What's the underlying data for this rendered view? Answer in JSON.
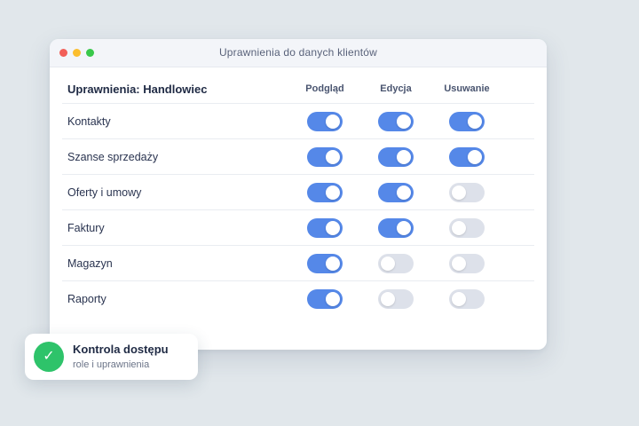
{
  "window": {
    "title": "Uprawnienia do danych klientów"
  },
  "table": {
    "role_label": "Uprawnienia: Handlowiec",
    "columns": [
      "Podgląd",
      "Edycja",
      "Usuwanie"
    ],
    "rows": [
      {
        "label": "Kontakty",
        "values": [
          true,
          true,
          true
        ]
      },
      {
        "label": "Szanse sprzedaży",
        "values": [
          true,
          true,
          true
        ]
      },
      {
        "label": "Oferty i umowy",
        "values": [
          true,
          true,
          false
        ]
      },
      {
        "label": "Faktury",
        "values": [
          true,
          true,
          false
        ]
      },
      {
        "label": "Magazyn",
        "values": [
          true,
          false,
          false
        ]
      },
      {
        "label": "Raporty",
        "values": [
          true,
          false,
          false
        ]
      }
    ]
  },
  "badge": {
    "title": "Kontrola dostępu",
    "subtitle": "role i uprawnienia",
    "icon": "check-icon"
  },
  "colors": {
    "toggle_on": "#5588e8",
    "toggle_off": "#dde1ea",
    "success": "#2ec36a"
  }
}
